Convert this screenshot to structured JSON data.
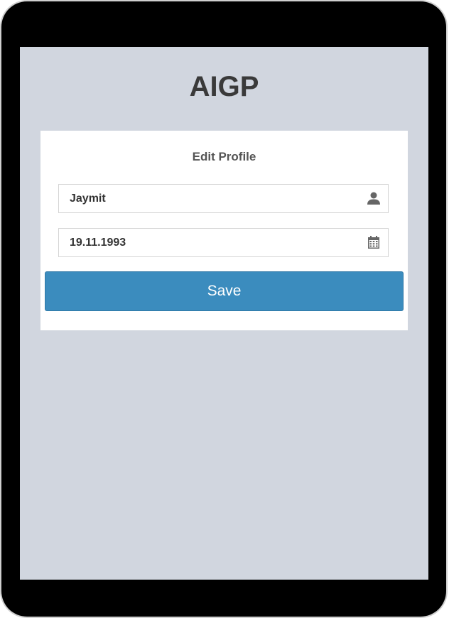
{
  "app": {
    "title": "AIGP"
  },
  "form": {
    "title": "Edit Profile",
    "name_field": {
      "value": "Jaymit",
      "icon": "user-icon"
    },
    "dob_field": {
      "value": "19.11.1993",
      "icon": "calendar-icon"
    },
    "save_label": "Save"
  },
  "colors": {
    "screen_background": "#d1d6df",
    "button_primary": "#3b8cbe",
    "device_frame": "#000000"
  }
}
